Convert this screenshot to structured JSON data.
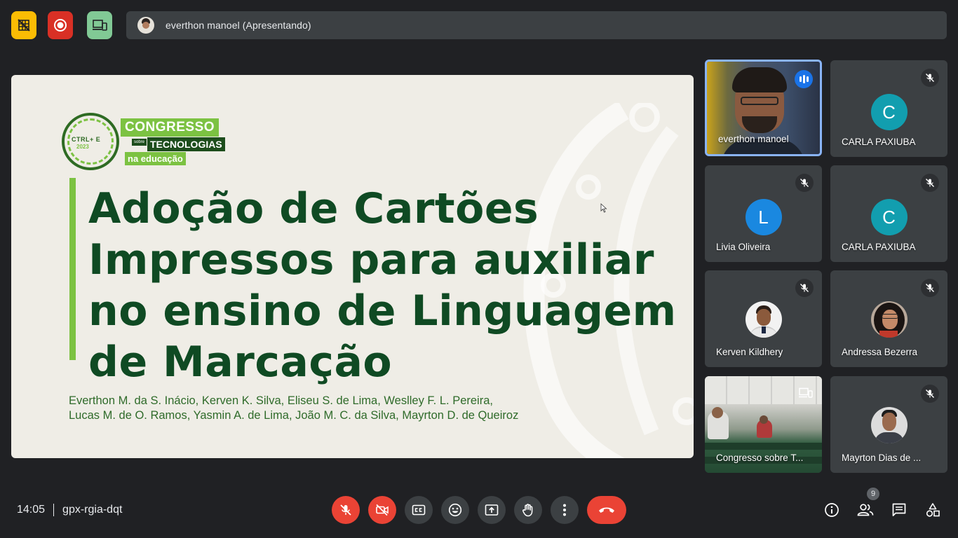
{
  "top_bar": {
    "presenter_label": "everthon manoel (Apresentando)"
  },
  "slide": {
    "logo": {
      "ring_text": "CTRL+ E",
      "year": "2023",
      "word1": "CONGRESSO",
      "word_small": "sobre",
      "word2": "TECNOLOGIAS",
      "word3": "na educação"
    },
    "title_lines": [
      "Adoção de Cartões",
      "Impressos para auxiliar",
      "no ensino de Linguagem",
      "de Marcação"
    ],
    "authors_lines": [
      "Everthon M. da S. Inácio, Kerven K. Silva, Eliseu S. de Lima, Weslley F. L. Pereira,",
      "Lucas M. de O. Ramos, Yasmin A. de Lima, João M. C. da Silva, Mayrton D. de Queiroz"
    ]
  },
  "participants": [
    {
      "name": "everthon manoel",
      "kind": "video",
      "state": "speaking"
    },
    {
      "name": "CARLA PAXIUBA",
      "kind": "initial",
      "initial": "C",
      "color": "#129eaf",
      "state": "muted"
    },
    {
      "name": "Livia Oliveira",
      "kind": "initial",
      "initial": "L",
      "color": "#1a88e0",
      "state": "muted"
    },
    {
      "name": "CARLA PAXIUBA",
      "kind": "initial",
      "initial": "C",
      "color": "#129eaf",
      "state": "muted"
    },
    {
      "name": "Kerven Kildhery",
      "kind": "photo",
      "state": "muted"
    },
    {
      "name": "Andressa Bezerra",
      "kind": "photo",
      "state": "muted"
    },
    {
      "name": "Congresso sobre T...",
      "kind": "video",
      "state": "presenting"
    },
    {
      "name": "Mayrton Dias de ...",
      "kind": "photo",
      "state": "muted"
    }
  ],
  "bottom_bar": {
    "time": "14:05",
    "meeting_code": "gpx-rgia-dqt",
    "people_count": "9"
  },
  "colors": {
    "background": "#202124",
    "surface": "#3c4043",
    "danger": "#ea4335",
    "accent_blue": "#8ab4f8",
    "slide_green": "#0f4a23",
    "slide_light_green": "#7cc242"
  }
}
